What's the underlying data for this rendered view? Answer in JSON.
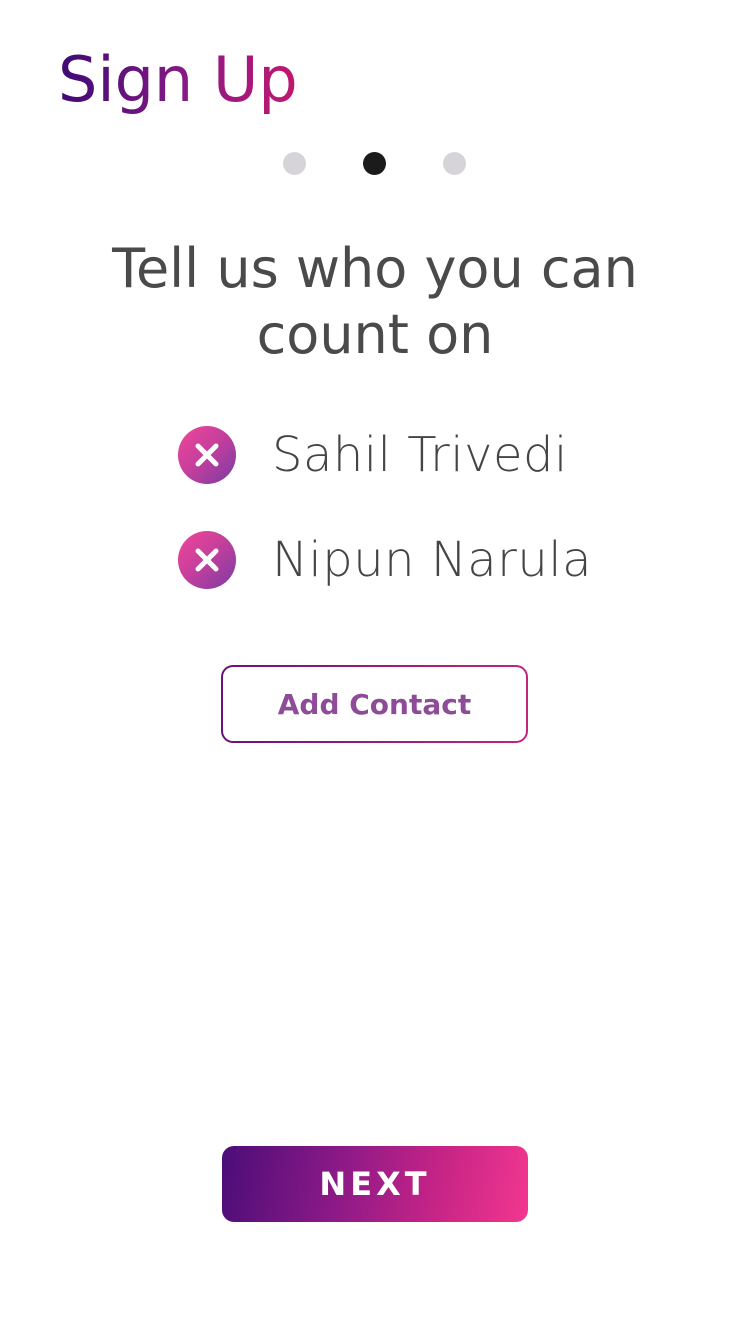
{
  "header": {
    "title": "Sign Up"
  },
  "progress": {
    "steps": 3,
    "current_step": 2
  },
  "main": {
    "heading": "Tell us who you can count on",
    "contacts": [
      {
        "name": "Sahil Trivedi",
        "remove_icon": "close-icon"
      },
      {
        "name": "Nipun Narula",
        "remove_icon": "close-icon"
      }
    ],
    "add_contact_label": "Add Contact"
  },
  "footer": {
    "next_label": "NEXT"
  },
  "colors": {
    "gradient_start": "#4a0d78",
    "gradient_end": "#f2378f",
    "active_dot": "#1b1b1b",
    "inactive_dot": "#d6d4d8",
    "text": "#4a4a4a"
  }
}
